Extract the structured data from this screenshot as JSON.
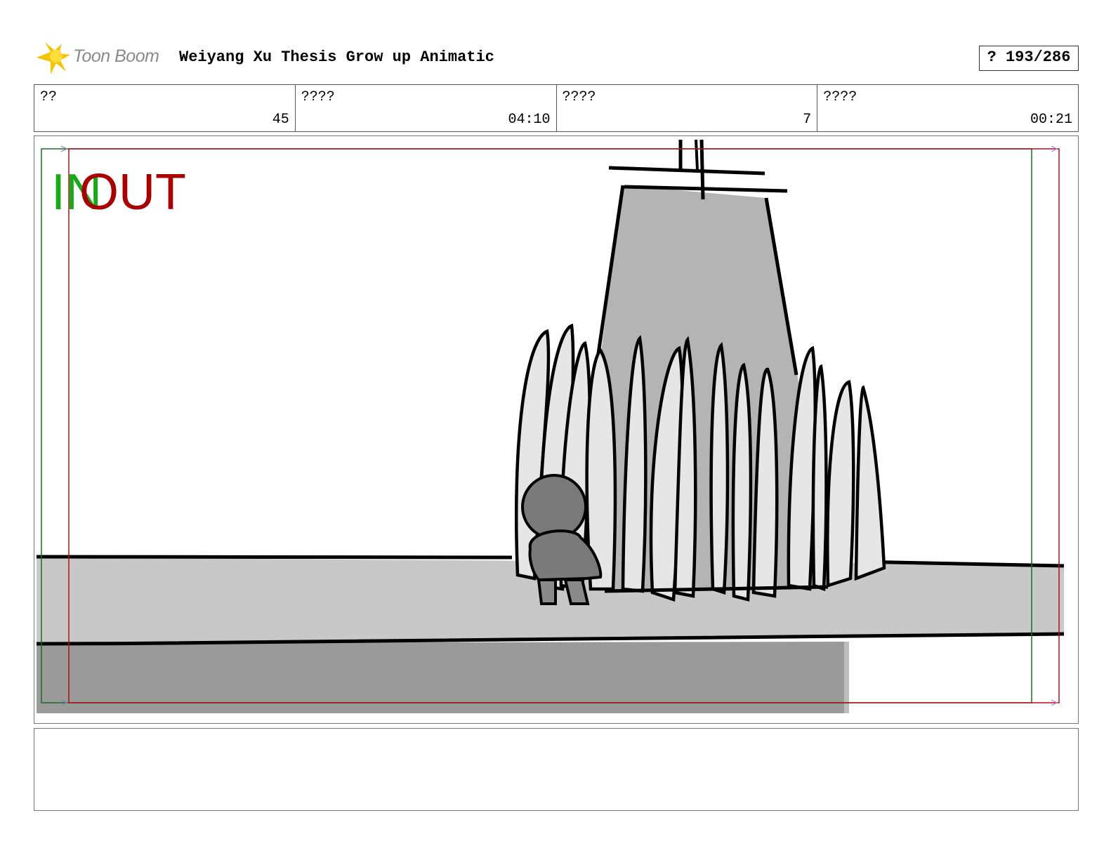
{
  "header": {
    "brand": "Toon Boom",
    "project_title": "Weiyang Xu Thesis Grow up Animatic",
    "page_counter": "? 193/286"
  },
  "info": [
    {
      "label": "??",
      "value": "45"
    },
    {
      "label": "????",
      "value": "04:10"
    },
    {
      "label": "????",
      "value": "7"
    },
    {
      "label": "????",
      "value": "00:21"
    }
  ],
  "panel": {
    "in_label": "IN",
    "out_label": "OUT"
  },
  "colors": {
    "in_marker": "#18a818",
    "out_marker": "#a80000",
    "logo_yellow": "#f5c400"
  },
  "notes": ""
}
